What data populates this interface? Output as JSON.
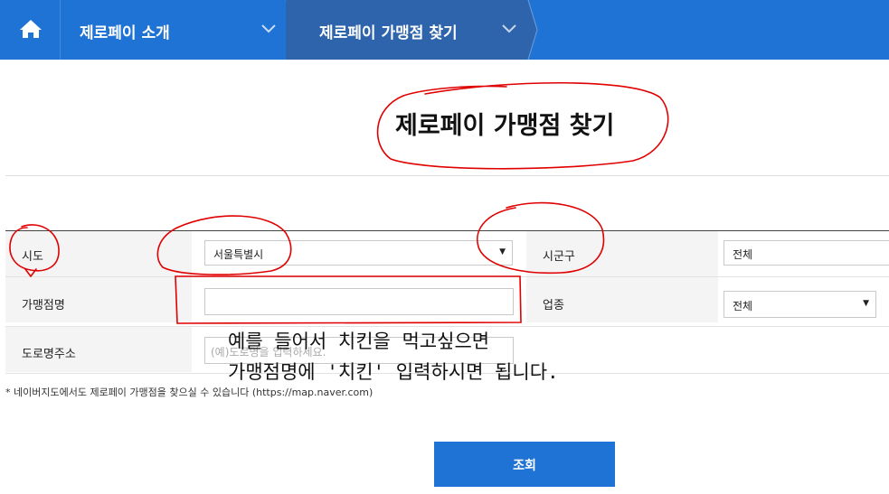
{
  "nav": {
    "items": [
      {
        "label": "제로페이 소개"
      },
      {
        "label": "제로페이 가맹점 찾기"
      }
    ]
  },
  "page": {
    "title": "제로페이 가맹점 찾기"
  },
  "form": {
    "sido_label": "시도",
    "sido_value": "서울특별시",
    "sigungu_label": "시군구",
    "sigungu_value": "전체",
    "store_name_label": "가맹점명",
    "store_name_value": "",
    "category_label": "업종",
    "category_value": "전체",
    "road_address_label": "도로명주소",
    "road_address_placeholder": "(예)도로명을 입력하세요."
  },
  "note": "* 네이버지도에서도 제로페이 가맹점을 찾으실 수 있습니다 (https://map.naver.com)",
  "search_button": "조회",
  "annotation": {
    "line1": "예를 들어서 치킨을 먹고싶으면",
    "line2": "가맹점명에 '치킨' 입력하시면 됩니다."
  },
  "colors": {
    "nav_bg": "#1f73d4",
    "nav_active": "#2e64ab",
    "button": "#1f73d4",
    "annotation": "#e00000"
  },
  "icons": [
    "home-icon",
    "chevron-down-icon",
    "dropdown-caret-icon"
  ]
}
